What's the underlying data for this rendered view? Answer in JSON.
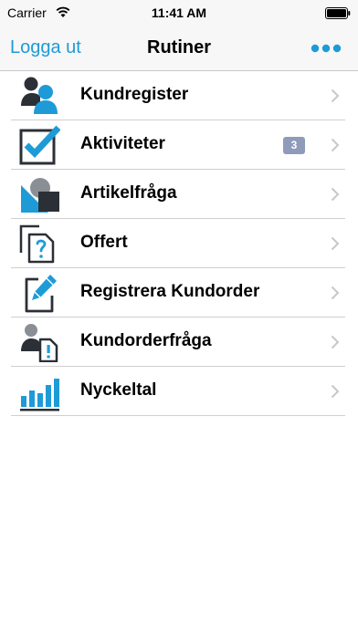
{
  "status_bar": {
    "carrier": "Carrier",
    "time": "11:41 AM"
  },
  "nav": {
    "left_label": "Logga ut",
    "title": "Rutiner",
    "more_icon": "ellipsis-icon"
  },
  "colors": {
    "accent": "#1e9bd7",
    "dark": "#2b2f36",
    "badge": "#8e9cba"
  },
  "menu": {
    "items": [
      {
        "label": "Kundregister",
        "icon": "users-icon"
      },
      {
        "label": "Aktiviteter",
        "icon": "checkbox-icon",
        "badge": "3"
      },
      {
        "label": "Artikelfråga",
        "icon": "article-query-icon"
      },
      {
        "label": "Offert",
        "icon": "document-question-icon"
      },
      {
        "label": "Registrera Kundorder",
        "icon": "edit-document-icon"
      },
      {
        "label": "Kundorderfråga",
        "icon": "customer-order-query-icon"
      },
      {
        "label": "Nyckeltal",
        "icon": "bar-chart-icon"
      }
    ]
  }
}
